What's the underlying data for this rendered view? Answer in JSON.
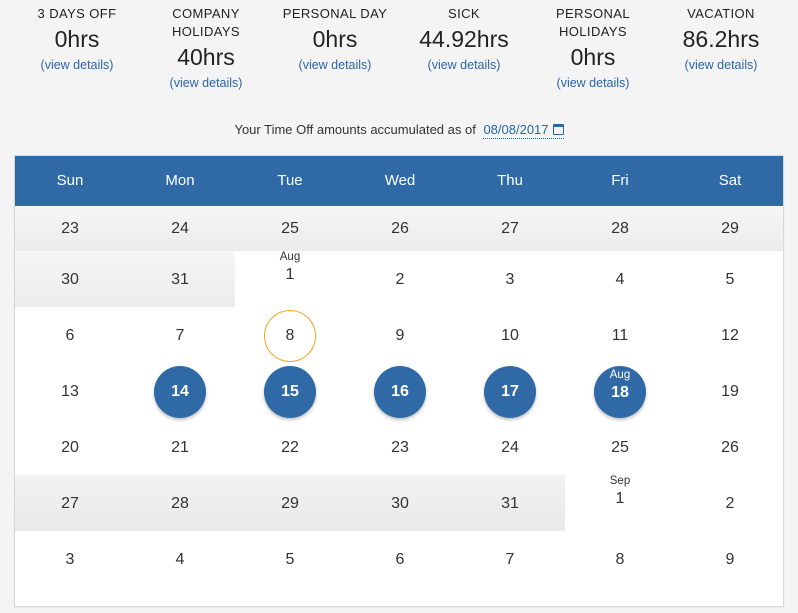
{
  "summary": [
    {
      "label": "3 DAYS OFF",
      "value": "0hrs",
      "link": "(view details)"
    },
    {
      "label": "COMPANY HOLIDAYS",
      "value": "40hrs",
      "link": "(view details)"
    },
    {
      "label": "PERSONAL DAY",
      "value": "0hrs",
      "link": "(view details)"
    },
    {
      "label": "SICK",
      "value": "44.92hrs",
      "link": "(view details)"
    },
    {
      "label": "PERSONAL HOLIDAYS",
      "value": "0hrs",
      "link": "(view details)"
    },
    {
      "label": "VACATION",
      "value": "86.2hrs",
      "link": "(view details)"
    }
  ],
  "asof": {
    "text": "Your Time Off amounts accumulated as of",
    "date": "08/08/2017",
    "icon": "calendar-icon"
  },
  "calendar": {
    "weekdays": [
      "Sun",
      "Mon",
      "Tue",
      "Wed",
      "Thu",
      "Fri",
      "Sat"
    ],
    "header_color": "#2f6aa7",
    "today_ring_color": "#f2a623",
    "weeks": [
      [
        "23",
        "24",
        "25",
        "26",
        "27",
        "28",
        "29"
      ],
      [
        "30",
        "31",
        "1",
        "2",
        "3",
        "4",
        "5"
      ],
      [
        "6",
        "7",
        "8",
        "9",
        "10",
        "11",
        "12"
      ],
      [
        "13",
        "14",
        "15",
        "16",
        "17",
        "18",
        "19"
      ],
      [
        "20",
        "21",
        "22",
        "23",
        "24",
        "25",
        "26"
      ],
      [
        "27",
        "28",
        "29",
        "30",
        "31",
        "1",
        "2"
      ],
      [
        "3",
        "4",
        "5",
        "6",
        "7",
        "8",
        "9"
      ]
    ],
    "month_labels": [
      {
        "week": 1,
        "day": 2,
        "text": "Aug"
      },
      {
        "week": 3,
        "day": 5,
        "text": "Aug"
      },
      {
        "week": 5,
        "day": 5,
        "text": "Sep"
      }
    ],
    "today": {
      "week": 2,
      "day": 2
    },
    "time_off_days": [
      {
        "week": 3,
        "day": 1
      },
      {
        "week": 3,
        "day": 2
      },
      {
        "week": 3,
        "day": 3
      },
      {
        "week": 3,
        "day": 4
      },
      {
        "week": 3,
        "day": 5
      }
    ]
  }
}
